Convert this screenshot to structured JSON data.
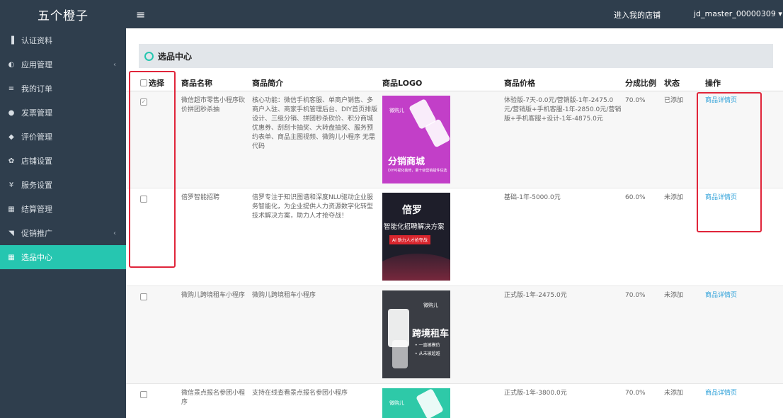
{
  "brand": "五个橙子",
  "hamburger_icon": "menu-icon",
  "topbar": {
    "store_link": "进入我的店铺",
    "username": "jd_master_00000309 ▾"
  },
  "sidebar": {
    "items": [
      {
        "icon": "▐",
        "label": "认证资料"
      },
      {
        "icon": "◐",
        "label": "应用管理",
        "chevron": "‹"
      },
      {
        "icon": "≡",
        "label": "我的订单"
      },
      {
        "icon": "●",
        "label": "发票管理"
      },
      {
        "icon": "◆",
        "label": "评价管理"
      },
      {
        "icon": "✿",
        "label": "店铺设置"
      },
      {
        "icon": "¥",
        "label": "服务设置"
      },
      {
        "icon": "▦",
        "label": "结算管理"
      },
      {
        "icon": "◥",
        "label": "促销推广",
        "chevron": "‹"
      },
      {
        "icon": "▦",
        "label": "选品中心"
      }
    ]
  },
  "section": {
    "title": "选品中心"
  },
  "table": {
    "headers": {
      "select": "选择",
      "name": "商品名称",
      "intro": "商品简介",
      "logo": "商品LOGO",
      "price": "商品价格",
      "ratio": "分成比例",
      "status": "状态",
      "action": "操作"
    },
    "rows": [
      {
        "checked": "✓",
        "name": "微信超市零售小程序砍价拼团秒杀抽",
        "intro": "核心功能：微信手机客服、单商户销售、多商户入驻、商家手机管理后台、DIY首页排版设计、三级分销、拼团秒杀砍价、积分商城优惠券、刮刮卡抽奖、大转盘抽奖、服务预约表单、商品主图视频、微购儿小程序 无需代码",
        "logo_title": "分销商城",
        "logo_sub": "DIY可视化装修，量十级营销插件任选",
        "logo_brand": "微购儿",
        "price": "体验版-7天-0.0元/营销版-1年-2475.0元/营销版+手机客服-1年-2850.0元/营销版+手机客服+设计-1年-4875.0元",
        "ratio": "70.0%",
        "status": "已添加",
        "action": "商品详情页"
      },
      {
        "checked": "",
        "name": "倍罗智能招聘",
        "intro": "倍罗专注于知识图谱和深度NLU驱动企业服务智能化，为企业提供人力资源数字化转型技术解决方案，助力人才抢夺战！",
        "logo_title": "倍罗",
        "logo_sub": "智能化招聘解决方案",
        "logo_tag": "AI 助力人才抢夺战",
        "price": "基础-1年-5000.0元",
        "ratio": "60.0%",
        "status": "未添加",
        "action": "商品详情页"
      },
      {
        "checked": "",
        "name": "微购儿跨境租车小程序",
        "intro": "微购儿跨境租车小程序",
        "logo_title": "跨境租车",
        "logo_sub1": "• 一直被模仿",
        "logo_sub2": "• 从未被超越",
        "logo_brand": "微购儿",
        "price": "正式版-1年-2475.0元",
        "ratio": "70.0%",
        "status": "未添加",
        "action": "商品详情页"
      },
      {
        "checked": "",
        "name": "微信景点报名参团小程序",
        "intro": "支持在线查看景点报名参团小程序",
        "logo_brand": "微购儿",
        "price": "正式版-1年-3800.0元",
        "ratio": "70.0%",
        "status": "未添加",
        "action": "商品详情页"
      }
    ]
  }
}
